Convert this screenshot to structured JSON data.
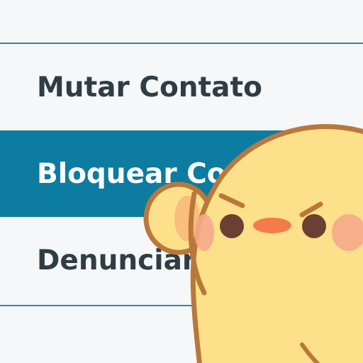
{
  "menu": {
    "items": [
      {
        "label": "Mutar Contato",
        "selected": false
      },
      {
        "label": "Bloquear Contato",
        "selected": true
      },
      {
        "label": "Denunciar",
        "selected": false
      }
    ]
  },
  "colors": {
    "accent": "#0c7ca0",
    "divider": "#2f86a8",
    "text": "#2f3d45",
    "background": "#f6f7f8",
    "sticker_body": "#fde08a",
    "sticker_outline": "#b9783a"
  },
  "sticker": {
    "icon": "angry-chick-sticker-icon"
  }
}
